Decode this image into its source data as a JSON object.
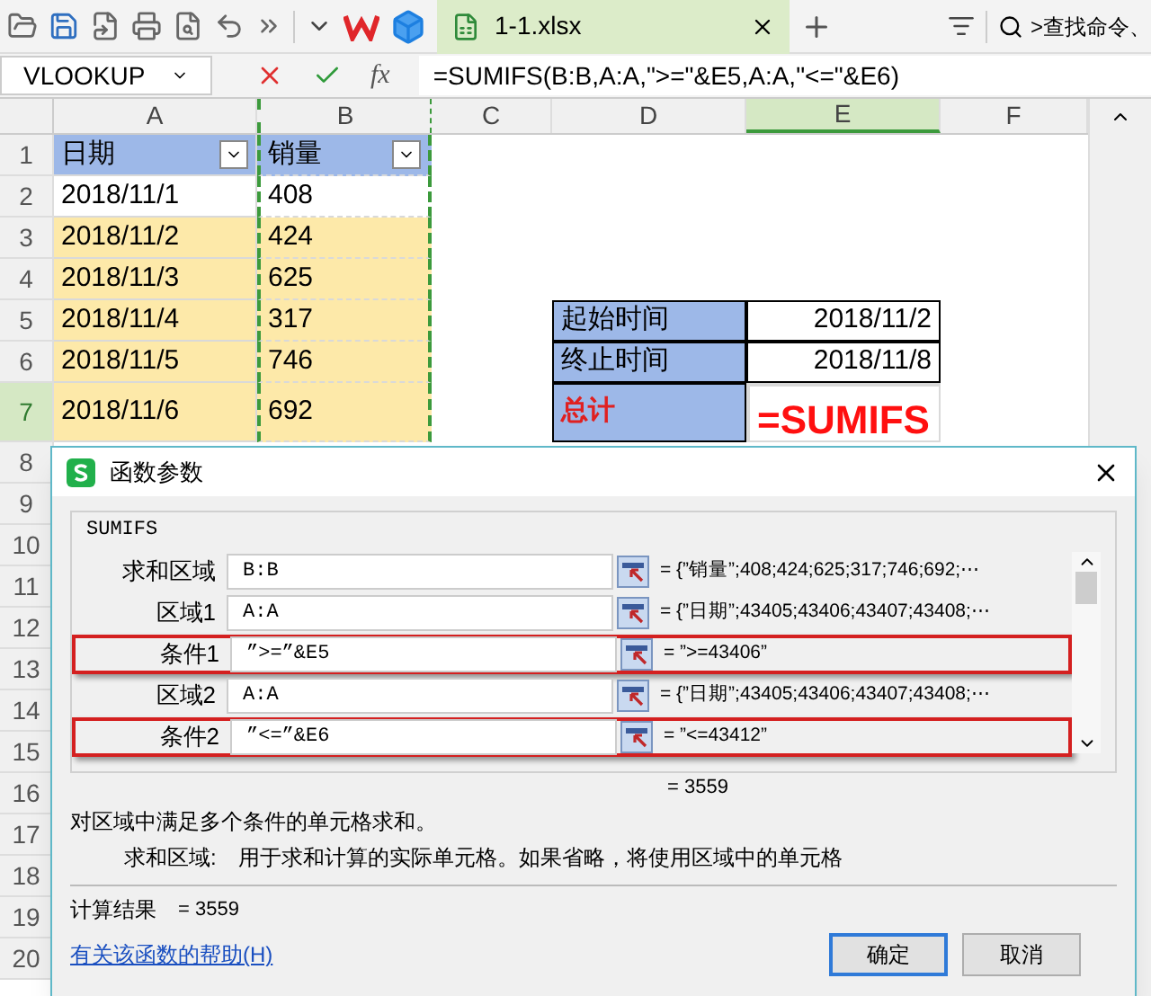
{
  "toolbar": {
    "tab": {
      "label": "1-1.xlsx",
      "selected": true
    },
    "search": ">查找命令、"
  },
  "formula_bar": {
    "name_box": "VLOOKUP",
    "fx": "fx",
    "formula": "=SUMIFS(B:B,A:A,\">=\"&E5,A:A,\"<=\"&E6)"
  },
  "columns": [
    {
      "label": "A",
      "selected": false,
      "copied": false
    },
    {
      "label": "B",
      "selected": false,
      "copied": true
    },
    {
      "label": "C",
      "selected": false,
      "copied": false
    },
    {
      "label": "D",
      "selected": false,
      "copied": false
    },
    {
      "label": "E",
      "selected": true,
      "copied": false
    },
    {
      "label": "F",
      "selected": false,
      "copied": false
    }
  ],
  "rows": [
    {
      "number": "1",
      "selected": false,
      "cells": [
        {
          "kind": "header",
          "text": "日期"
        },
        {
          "kind": "header",
          "text": "销量"
        },
        {
          "kind": "blank"
        },
        {
          "kind": "blank"
        },
        {
          "kind": "blank"
        },
        {
          "kind": "blank"
        }
      ]
    },
    {
      "number": "2",
      "selected": false,
      "cells": [
        {
          "kind": "plain",
          "text": "2018/11/1"
        },
        {
          "kind": "plain",
          "text": "408"
        },
        {
          "kind": "blank"
        },
        {
          "kind": "blank"
        },
        {
          "kind": "blank"
        },
        {
          "kind": "blank"
        }
      ]
    },
    {
      "number": "3",
      "selected": false,
      "cells": [
        {
          "kind": "marked",
          "text": "2018/11/2"
        },
        {
          "kind": "marked",
          "text": "424"
        },
        {
          "kind": "blank"
        },
        {
          "kind": "blank"
        },
        {
          "kind": "blank"
        },
        {
          "kind": "blank"
        }
      ]
    },
    {
      "number": "4",
      "selected": false,
      "cells": [
        {
          "kind": "marked",
          "text": "2018/11/3"
        },
        {
          "kind": "marked",
          "text": "625"
        },
        {
          "kind": "blank"
        },
        {
          "kind": "blank"
        },
        {
          "kind": "blank"
        },
        {
          "kind": "blank"
        }
      ]
    },
    {
      "number": "5",
      "selected": false,
      "cells": [
        {
          "kind": "marked",
          "text": "2018/11/4"
        },
        {
          "kind": "marked",
          "text": "317"
        },
        {
          "kind": "blank"
        },
        {
          "kind": "label",
          "text": "起始时间"
        },
        {
          "kind": "value",
          "text": "2018/11/2"
        },
        {
          "kind": "blank"
        }
      ]
    },
    {
      "number": "6",
      "selected": false,
      "cells": [
        {
          "kind": "marked",
          "text": "2018/11/5"
        },
        {
          "kind": "marked",
          "text": "746"
        },
        {
          "kind": "blank"
        },
        {
          "kind": "label",
          "text": "终止时间"
        },
        {
          "kind": "value",
          "text": "2018/11/8"
        },
        {
          "kind": "blank"
        }
      ]
    },
    {
      "number": "7",
      "selected": true,
      "cells": [
        {
          "kind": "marked",
          "text": "2018/11/6"
        },
        {
          "kind": "marked",
          "text": "692"
        },
        {
          "kind": "blank"
        },
        {
          "kind": "total",
          "text": "总计"
        },
        {
          "kind": "editing",
          "text": "=SUMIFS"
        },
        {
          "kind": "blank"
        }
      ]
    }
  ],
  "more_row_numbers": [
    "8",
    "9",
    "10",
    "11",
    "12",
    "13",
    "14",
    "15",
    "16",
    "17",
    "18",
    "19",
    "20"
  ],
  "dialog": {
    "title": "函数参数",
    "function": "SUMIFS",
    "args": [
      {
        "label": "求和区域",
        "value": "B:B",
        "result": "= {”销量”;408;424;625;317;746;692;⋯",
        "highlighted": false
      },
      {
        "label": "区域1",
        "value": "A:A",
        "result": "= {”日期”;43405;43406;43407;43408;⋯",
        "highlighted": false
      },
      {
        "label": "条件1",
        "value": "”>=”&E5",
        "result": "= ”>=43406”",
        "highlighted": true
      },
      {
        "label": "区域2",
        "value": "A:A",
        "result": "= {”日期”;43405;43406;43407;43408;⋯",
        "highlighted": false
      },
      {
        "label": "条件2",
        "value": "”<=”&E6",
        "result": "= ”<=43412”",
        "highlighted": true
      }
    ],
    "total": "= 3559",
    "description": "对区域中满足多个条件的单元格求和。",
    "arg_name": "求和区域:",
    "arg_help": "用于求和计算的实际单元格。如果省略，将使用区域中的单元格",
    "result_label": "计算结果",
    "result_value": "= 3559",
    "help_link": "有关该函数的帮助(H)",
    "buttons": [
      {
        "label": "确定",
        "default": true
      },
      {
        "label": "取消",
        "default": false
      }
    ]
  }
}
